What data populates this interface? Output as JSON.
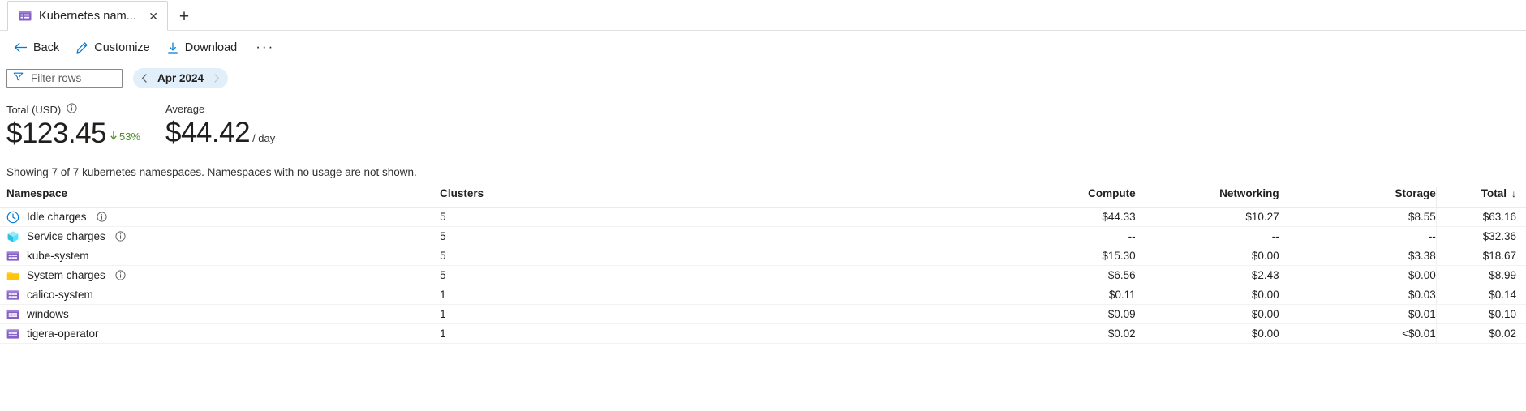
{
  "tab": {
    "title": "Kubernetes nam...",
    "icon": "namespace-icon",
    "close_label": "✕",
    "new_tab_label": "+"
  },
  "commandbar": {
    "items": [
      {
        "label": "Back",
        "icon": "back-arrow-icon"
      },
      {
        "label": "Customize",
        "icon": "pencil-icon"
      },
      {
        "label": "Download",
        "icon": "download-icon"
      }
    ],
    "more_label": "···"
  },
  "filterbar": {
    "filter_placeholder": "Filter rows",
    "filter_value": "",
    "filter_icon": "funnel-icon",
    "date": {
      "label": "Apr 2024",
      "prev_icon": "chevron-left-icon",
      "next_icon": "chevron-right-icon"
    }
  },
  "kpis": [
    {
      "label": "Total (USD)",
      "has_info": true,
      "value": "$123.45",
      "delta": "53%",
      "delta_direction": "down",
      "delta_color": "#4e8f25",
      "unit": ""
    },
    {
      "label": "Average",
      "has_info": false,
      "value": "$44.42",
      "delta": "",
      "unit": "/ day"
    }
  ],
  "showing_text": "Showing 7 of 7 kubernetes namespaces. Namespaces with no usage are not shown.",
  "table": {
    "columns": [
      {
        "key": "namespace",
        "label": "Namespace",
        "align": "left"
      },
      {
        "key": "clusters",
        "label": "Clusters",
        "align": "left"
      },
      {
        "key": "compute",
        "label": "Compute",
        "align": "right"
      },
      {
        "key": "networking",
        "label": "Networking",
        "align": "right"
      },
      {
        "key": "storage",
        "label": "Storage",
        "align": "right"
      },
      {
        "key": "total",
        "label": "Total",
        "align": "right",
        "sorted": "desc",
        "sort_icon": "↓"
      }
    ],
    "rows": [
      {
        "namespace": "Idle charges",
        "icon": "clock-icon",
        "has_info": true,
        "clusters": "5",
        "compute": "$44.33",
        "networking": "$10.27",
        "storage": "$8.55",
        "total": "$63.16"
      },
      {
        "namespace": "Service charges",
        "icon": "cube-icon",
        "has_info": true,
        "clusters": "5",
        "compute": "--",
        "networking": "--",
        "storage": "--",
        "total": "$32.36"
      },
      {
        "namespace": "kube-system",
        "icon": "namespace-icon",
        "has_info": false,
        "clusters": "5",
        "compute": "$15.30",
        "networking": "$0.00",
        "storage": "$3.38",
        "total": "$18.67"
      },
      {
        "namespace": "System charges",
        "icon": "folder-icon",
        "has_info": true,
        "clusters": "5",
        "compute": "$6.56",
        "networking": "$2.43",
        "storage": "$0.00",
        "total": "$8.99"
      },
      {
        "namespace": "calico-system",
        "icon": "namespace-icon",
        "has_info": false,
        "clusters": "1",
        "compute": "$0.11",
        "networking": "$0.00",
        "storage": "$0.03",
        "total": "$0.14"
      },
      {
        "namespace": "windows",
        "icon": "namespace-icon",
        "has_info": false,
        "clusters": "1",
        "compute": "$0.09",
        "networking": "$0.00",
        "storage": "$0.01",
        "total": "$0.10"
      },
      {
        "namespace": "tigera-operator",
        "icon": "namespace-icon",
        "has_info": false,
        "clusters": "1",
        "compute": "$0.02",
        "networking": "$0.00",
        "storage": "<$0.01",
        "total": "$0.02"
      }
    ]
  },
  "colors": {
    "accent": "#0078d4",
    "pill_bg": "#e1effa",
    "positive_green": "#4e8f25",
    "namespace_purple": "#8661c5",
    "folder_yellow": "#ffb900",
    "cube_cyan": "#50e6ff"
  }
}
